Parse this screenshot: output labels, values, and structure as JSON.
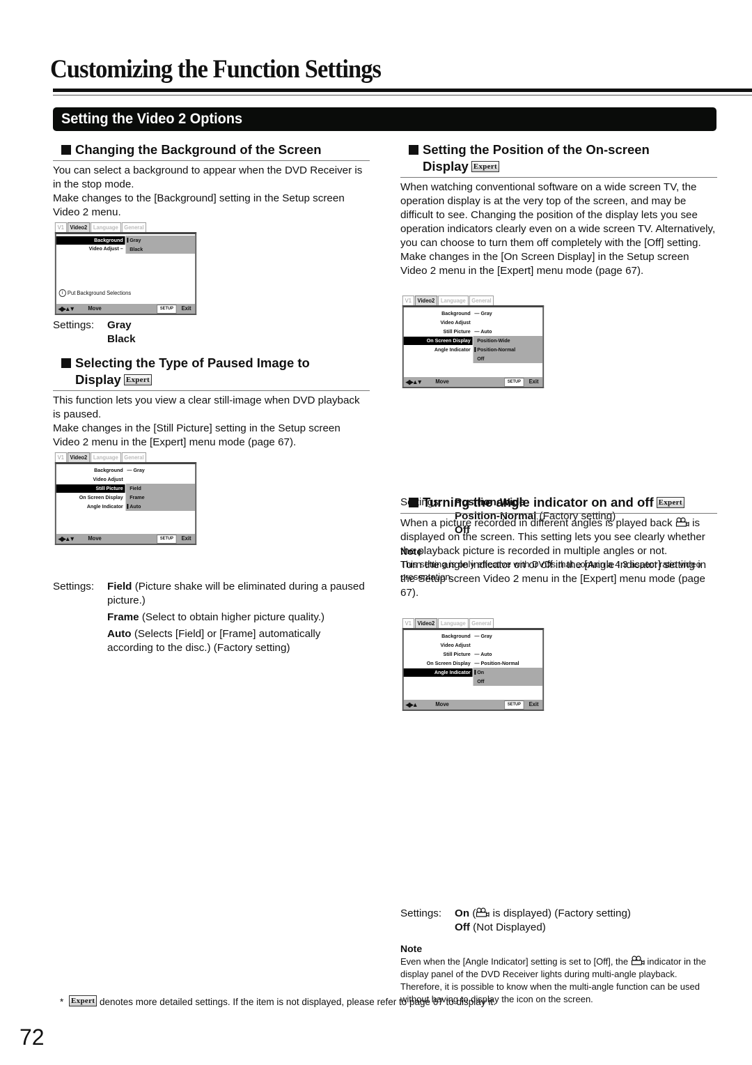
{
  "page": {
    "title": "Customizing the Function Settings",
    "section": "Setting the Video 2 Options",
    "page_number": "72",
    "expert_badge": "Expert",
    "footnote_star": "*",
    "footnote": "denotes more detailed settings. If the item is not displayed, please refer to page 67 to display it."
  },
  "background": {
    "heading": "Changing the Background of the Screen",
    "body": "You can select a background to appear when the DVD Receiver is in the stop mode.",
    "body2": "Make changes to the [Background] setting in the Setup screen Video 2 menu.",
    "settings_label": "Settings:",
    "settings": [
      "Gray",
      "Black"
    ],
    "menu": {
      "tabs": [
        "V1",
        "Video2",
        "Language",
        "General"
      ],
      "rows": [
        "Background",
        "Video Adjust –"
      ],
      "options": [
        "Gray",
        "Black"
      ],
      "info": "Put Background Selections",
      "info_icon": "i",
      "move": "Move",
      "setup": "SETUP",
      "exit": "Exit"
    }
  },
  "paused": {
    "heading_line1": "Selecting the Type of Paused Image to",
    "heading_line2": "Display",
    "body": "This function lets you view a clear still-image when DVD playback is paused.",
    "body2": "Make changes in the [Still Picture] setting in the Setup screen Video 2 menu in the [Expert] menu mode (page 67).",
    "settings_label": "Settings:",
    "settings": [
      {
        "name": "Field",
        "desc": "(Picture shake will be eliminated during a paused picture.)"
      },
      {
        "name": "Frame",
        "desc": "(Select to obtain higher picture quality.)"
      },
      {
        "name": "Auto",
        "desc": "(Selects [Field] or [Frame] automatically according to the disc.) (Factory setting)"
      }
    ],
    "menu": {
      "tabs": [
        "V1",
        "Video2",
        "Language",
        "General"
      ],
      "rows": [
        "Background",
        "Video Adjust",
        "Still Picture",
        "On Screen Display",
        "Angle Indicator"
      ],
      "row_values": [
        "— Gray",
        "",
        "",
        "",
        ""
      ],
      "options": [
        "Field",
        "Frame",
        "Auto"
      ],
      "move": "Move",
      "setup": "SETUP",
      "exit": "Exit"
    }
  },
  "position": {
    "heading_line1": "Setting the Position of the On-screen",
    "heading_line2": "Display",
    "body": "When watching conventional software on a wide screen TV, the operation display is at the very top of the screen, and may be difficult to see. Changing the position of the display lets you see operation indicators clearly even on a wide screen TV. Alternatively, you can choose to turn them off completely with the [Off] setting.",
    "body2": "Make changes in the [On Screen Display] in the Setup screen Video 2 menu in the [Expert] menu mode (page 67).",
    "settings_label": "Settings:",
    "settings": [
      {
        "name": "Position-Wide",
        "desc": ""
      },
      {
        "name": "Position-Normal",
        "desc": "(Factory setting)"
      },
      {
        "name": "Off",
        "desc": ""
      }
    ],
    "note_heading": "Note",
    "note": "This setting is only effective with DVDs that contain a 4:3 aspect ratio video presentation.",
    "menu": {
      "tabs": [
        "V1",
        "Video2",
        "Language",
        "General"
      ],
      "rows": [
        "Background",
        "Video Adjust",
        "Still Picture",
        "On Screen Display",
        "Angle Indicator"
      ],
      "row_values": [
        "— Gray",
        "",
        "— Auto",
        "",
        ""
      ],
      "options": [
        "Position-Wide",
        "Position-Normal",
        "Off"
      ],
      "move": "Move",
      "setup": "SETUP",
      "exit": "Exit"
    }
  },
  "angle": {
    "heading": "Turning the angle indicator on and off",
    "body_a": "When a picture recorded in different angles is played back",
    "body_b": "is displayed on the screen. This setting lets you see clearly whether the playback picture is recorded in multiple angles or not.",
    "body2": "Turn the angle indicator on or off in the [Angle Indicator] setting in the Setup screen Video 2 menu in the [Expert] menu mode (page 67).",
    "settings_label": "Settings:",
    "on_name": "On",
    "on_desc_a": "(",
    "on_desc_b": "is displayed) (Factory setting)",
    "off_name": "Off",
    "off_desc": "(Not Displayed)",
    "note_heading": "Note",
    "note_a": "Even when the [Angle Indicator] setting is set to [Off], the",
    "note_b": "indicator in the display panel of the DVD Receiver lights during multi-angle playback. Therefore, it is possible to know when the multi-angle function can be used without having to display the icon on the screen.",
    "menu": {
      "tabs": [
        "V1",
        "Video2",
        "Language",
        "General"
      ],
      "rows": [
        "Background",
        "Video Adjust",
        "Still Picture",
        "On Screen Display",
        "Angle Indicator"
      ],
      "row_values": [
        "— Gray",
        "",
        "— Auto",
        "— Position-Normal",
        ""
      ],
      "options": [
        "On",
        "Off"
      ],
      "move": "Move",
      "setup": "SETUP",
      "exit": "Exit"
    }
  }
}
